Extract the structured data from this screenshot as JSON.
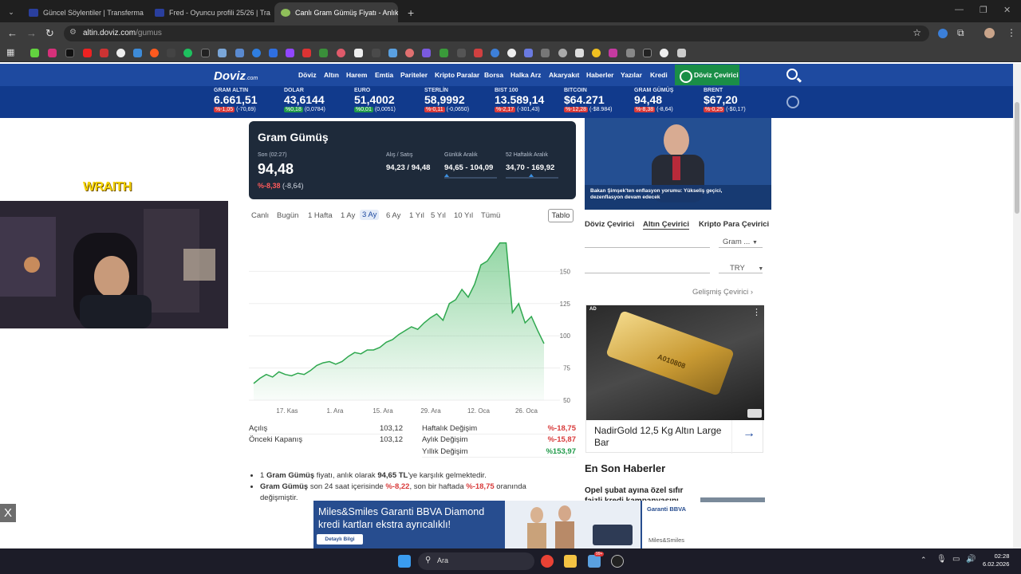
{
  "browser": {
    "tabs": [
      {
        "title": "Güncel Söylentiler | Transfermark"
      },
      {
        "title": "Fred - Oyuncu profili 25/26 | Tra"
      },
      {
        "title": "Canlı Gram Gümüş Fiyatı - Anlık"
      }
    ],
    "url_domain": "altin.doviz.com",
    "url_path": "/gumus"
  },
  "site": {
    "logo": "Doviz",
    "logo_suffix": ".com",
    "nav": [
      "Döviz",
      "Altın",
      "Harem",
      "Emtia",
      "Pariteler",
      "Kripto Paralar",
      "Borsa",
      "Halka Arz",
      "Akaryakıt",
      "Haberler",
      "Yazılar",
      "Kredi"
    ],
    "converter_button": "Döviz Çevirici"
  },
  "ticker": [
    {
      "name": "GRAM ALTIN",
      "value": "6.661,51",
      "pct": "%-1,05",
      "chg": "(-70,69)",
      "dir": "neg"
    },
    {
      "name": "DOLAR",
      "value": "43,6144",
      "pct": "%0,18",
      "chg": "(0,0784)",
      "dir": "pos"
    },
    {
      "name": "EURO",
      "value": "51,4002",
      "pct": "%0,01",
      "chg": "(0,0051)",
      "dir": "pos"
    },
    {
      "name": "STERLİN",
      "value": "58,9992",
      "pct": "%-0,11",
      "chg": "(-0,0650)",
      "dir": "neg"
    },
    {
      "name": "BIST 100",
      "value": "13.589,14",
      "pct": "%-2,17",
      "chg": "(-301,43)",
      "dir": "neg"
    },
    {
      "name": "BITCOIN",
      "value": "$64.271",
      "pct": "%-12,28",
      "chg": "(-$8.984)",
      "dir": "neg"
    },
    {
      "name": "GRAM GÜMÜŞ",
      "value": "94,48",
      "pct": "%-8,38",
      "chg": "(-8,64)",
      "dir": "neg"
    },
    {
      "name": "BRENT",
      "value": "$67,20",
      "pct": "%-0,25",
      "chg": "(-$0,17)",
      "dir": "neg"
    }
  ],
  "stream": {
    "overlay_text": "WRAITH"
  },
  "card": {
    "title": "Gram Gümüş",
    "last_label": "Son (02:27)",
    "last_value": "94,48",
    "last_pct": "%-8,38",
    "last_chg": "(-8,64)",
    "bidask_label": "Alış / Satış",
    "bidask_value": "94,23 / 94,48",
    "daily_label": "Günlük Aralık",
    "daily_value": "94,65 - 104,09",
    "weekly_label": "52 Haftalık Aralık",
    "weekly_value": "34,70 - 169,92"
  },
  "periods": [
    "Canlı",
    "Bugün",
    "1 Hafta",
    "1 Ay",
    "3 Ay",
    "6 Ay",
    "1 Yıl",
    "5 Yıl",
    "10 Yıl",
    "Tümü"
  ],
  "active_period": "3 Ay",
  "table_button": "Tablo",
  "chart_data": {
    "type": "area",
    "x_ticks": [
      "17. Kas",
      "1. Ara",
      "15. Ara",
      "29. Ara",
      "12. Oca",
      "26. Oca"
    ],
    "y_ticks": [
      50,
      75,
      100,
      125,
      150
    ],
    "ylim": [
      50,
      175
    ],
    "values": [
      63,
      67,
      70,
      68,
      72,
      70,
      69,
      71,
      70,
      73,
      77,
      79,
      80,
      78,
      80,
      84,
      87,
      86,
      89,
      89,
      91,
      95,
      97,
      101,
      104,
      107,
      105,
      110,
      114,
      117,
      112,
      125,
      128,
      136,
      130,
      140,
      155,
      158,
      165,
      172,
      172,
      118,
      125,
      110,
      115,
      104,
      94
    ],
    "color": "#3bb55a"
  },
  "stats": {
    "left": [
      {
        "label": "Açılış",
        "value": "103,12"
      },
      {
        "label": "Önceki Kapanış",
        "value": "103,12"
      }
    ],
    "right": [
      {
        "label": "Haftalık Değişim",
        "value": "%-18,75",
        "dir": "neg"
      },
      {
        "label": "Aylık Değişim",
        "value": "%-15,87",
        "dir": "neg"
      },
      {
        "label": "Yıllık Değişim",
        "value": "%153,97",
        "dir": "pos"
      }
    ]
  },
  "bullets": {
    "b1_pre": "1 ",
    "b1_bold1": "Gram Gümüş",
    "b1_mid": " fiyatı, anlık olarak ",
    "b1_bold2": "94,65 TL",
    "b1_post": "'ye karşılık gelmektedir.",
    "b2_bold1": "Gram Gümüş",
    "b2_mid1": " son 24 saat içerisinde ",
    "b2_red1": "%-8,22",
    "b2_mid2": ", son bir haftada ",
    "b2_red2": "%-18,75",
    "b2_post": " oranında",
    "b2_line2": "değişmiştir."
  },
  "news": {
    "caption": "Bakan Şimşek'ten enflasyon yorumu: Yükseliş geçici, dezenflasyon devam edecek"
  },
  "converter": {
    "tabs": [
      "Döviz Çevirici",
      "Altın Çevirici",
      "Kripto Para Çevirici"
    ],
    "active": "Altın Çevirici",
    "from": "Gram ...",
    "to": "TRY",
    "advanced": "Gelişmiş Çevirici"
  },
  "ad": {
    "label": "AD",
    "title": "NadirGold 12,5 Kg Altın Large Bar",
    "bar_text": "A010808"
  },
  "latest_news": {
    "heading": "En Son Haberler",
    "first": "Opel şubat ayına özel sıfır faizli kredi kampanyasını"
  },
  "banner": {
    "line1": "Miles&Smiles Garanti BBVA Diamond",
    "line2": "kredi kartları ekstra ayrıcalıklı!",
    "cta": "Detaylı Bilgi",
    "brand1": "Garanti BBVA",
    "brand2": "Miles&Smiles"
  },
  "close_label": "X",
  "taskbar": {
    "search": "Ara",
    "time": "02:28",
    "date": "6.02.2026",
    "badge": "99+"
  }
}
